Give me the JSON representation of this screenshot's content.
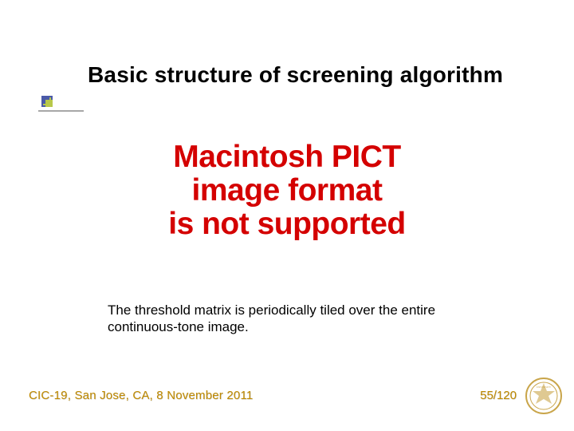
{
  "title": "Basic structure of screening algorithm",
  "pict_lines": {
    "l1": "Macintosh PICT",
    "l2": "image format",
    "l3": "is not supported"
  },
  "caption": "The threshold matrix is periodically tiled over the entire continuous-tone image.",
  "footer": {
    "venue": "CIC-19, San Jose, CA, 8 November 2011",
    "page": "55/120"
  },
  "icons": {
    "bullet": "bullet-square-icon",
    "logo": "purdue-seal-icon"
  },
  "colors": {
    "accent": "#c18b00",
    "error": "#d40000"
  }
}
